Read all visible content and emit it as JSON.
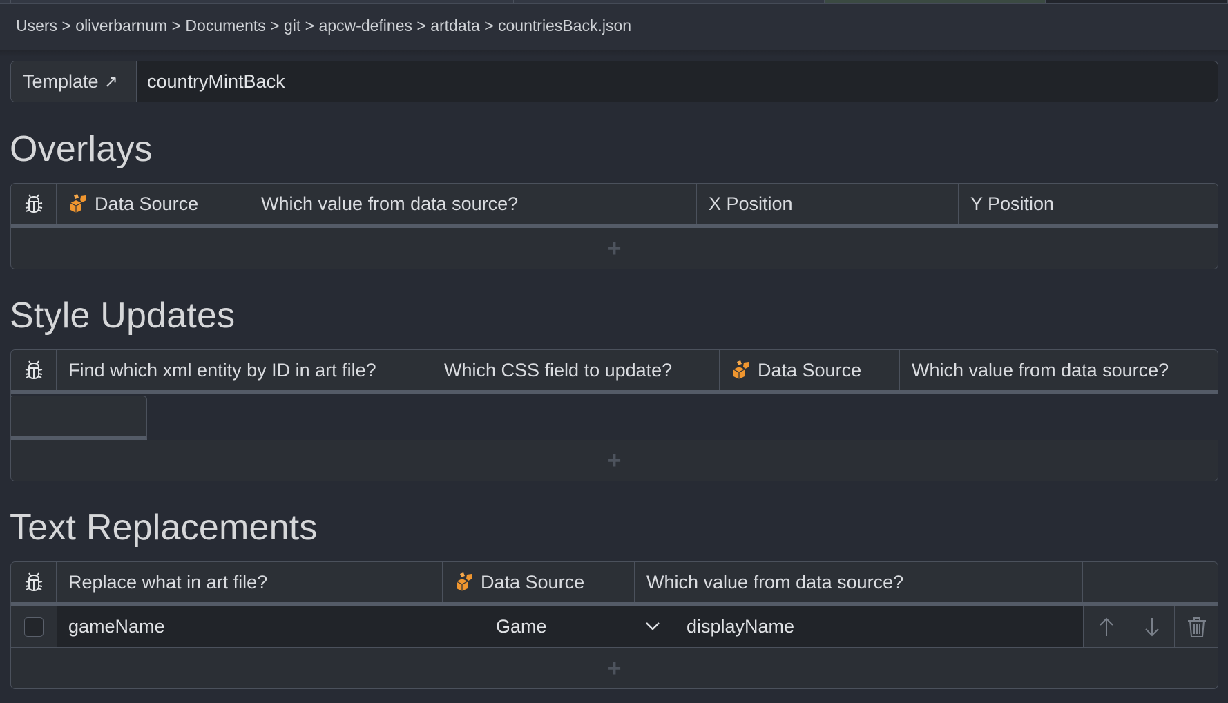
{
  "tabs_count": 8,
  "breadcrumb": {
    "path": [
      "Users",
      "oliverbarnum",
      "Documents",
      "git",
      "apcw-defines",
      "artdata",
      "countriesBack.json"
    ],
    "text": "Users > oliverbarnum > Documents > git > apcw-defines > artdata > countriesBack.json",
    "separator": ">"
  },
  "template": {
    "label": "Template",
    "link_icon": "arrow-up-right-icon",
    "value": "countryMintBack"
  },
  "colors": {
    "background": "#272b34",
    "panel": "#2b2f35",
    "border": "#4b515c",
    "accent_orange": "#f0962f",
    "text": "#d6d8dc"
  },
  "overlays": {
    "title": "Overlays",
    "columns": [
      {
        "icon": "bug-icon",
        "label": ""
      },
      {
        "icon": "data-source-icon",
        "label": "Data Source"
      },
      {
        "label": "Which value from data source?"
      },
      {
        "label": "X Position"
      },
      {
        "label": "Y Position"
      }
    ],
    "rows": [],
    "add_label": "+"
  },
  "style_updates": {
    "title": "Style Updates",
    "columns": [
      {
        "icon": "bug-icon",
        "label": ""
      },
      {
        "label": "Find which xml entity by ID in art file?"
      },
      {
        "label": "Which CSS field to update?"
      },
      {
        "icon": "data-source-icon",
        "label": "Data Source"
      },
      {
        "label": "Which value from data source?"
      }
    ],
    "rows": [],
    "add_label": "+"
  },
  "text_replacements": {
    "title": "Text Replacements",
    "columns": [
      {
        "icon": "bug-icon",
        "label": ""
      },
      {
        "label": "Replace what in art file?"
      },
      {
        "icon": "data-source-icon",
        "label": "Data Source"
      },
      {
        "label": "Which value from data source?"
      },
      {
        "label": ""
      }
    ],
    "rows": [
      {
        "checked": false,
        "replace": "gameName",
        "data_source": "Game",
        "value": "displayName",
        "actions": [
          "move-up",
          "move-down",
          "delete"
        ]
      }
    ],
    "add_label": "+"
  }
}
